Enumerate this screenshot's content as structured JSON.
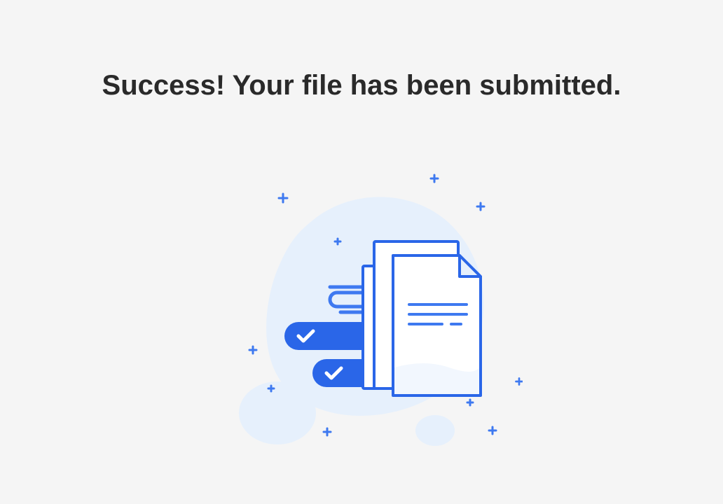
{
  "heading": "Success! Your file has been submitted.",
  "colors": {
    "accentBlue": "#2A66E8",
    "midBlue": "#3E79F0",
    "lightBlue": "#E6F0FC",
    "strokeBlue": "#2A66E8",
    "heading": "#2A2A2A",
    "bg": "#f5f5f5"
  }
}
